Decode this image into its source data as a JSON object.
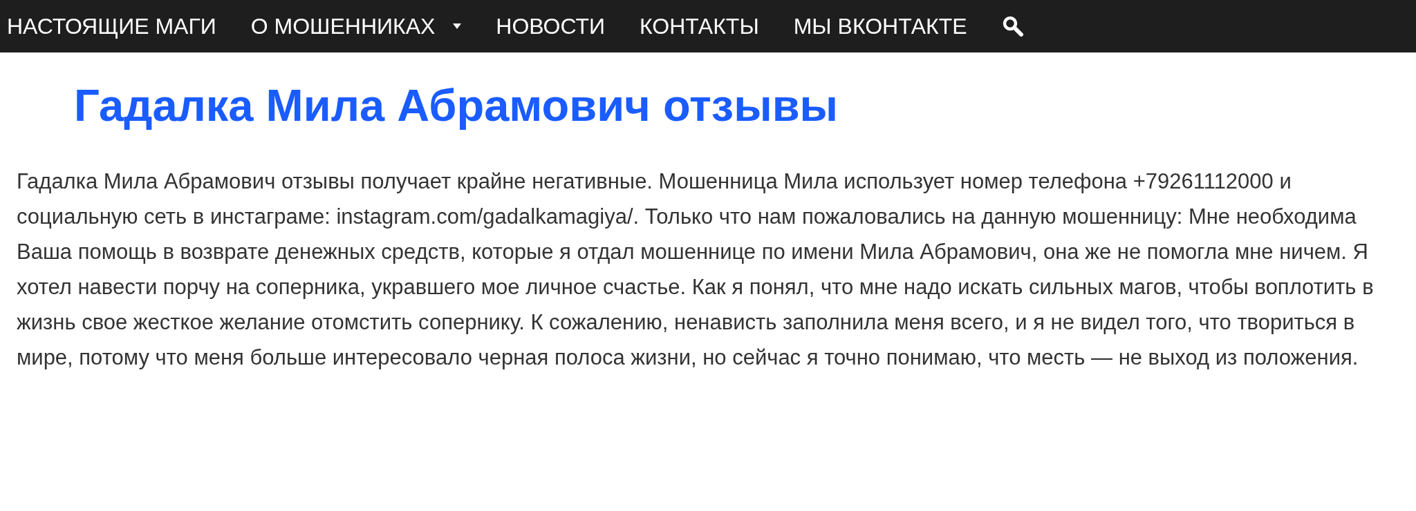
{
  "nav": {
    "items": [
      {
        "label": "НАСТОЯЩИЕ МАГИ",
        "dropdown": false
      },
      {
        "label": "О МОШЕННИКАХ",
        "dropdown": true
      },
      {
        "label": "НОВОСТИ",
        "dropdown": false
      },
      {
        "label": "КОНТАКТЫ",
        "dropdown": false
      },
      {
        "label": "МЫ ВКОНТАКТЕ",
        "dropdown": false
      }
    ]
  },
  "title": "Гадалка Мила Абрамович отзывы",
  "body": "Гадалка Мила Абрамович отзывы получает крайне негативные. Мошенница Мила использует номер телефона +79261112000 и социальную сеть в инстаграме: instagram.com/gadalkamagiya/. Только что нам пожаловались на данную мошенницу: Мне необходима Ваша помощь в возврате денежных средств, которые я отдал мошеннице по имени Мила Абрамович, она же не помогла мне ничем. Я хотел навести порчу на соперника, укравшего мое личное счастье. Как я понял, что мне надо искать сильных магов, чтобы воплотить в жизнь свое жесткое желание отомстить сопернику. К сожалению, ненависть заполнила меня всего, и я не видел того, что твориться в мире, потому что меня больше интересовало черная полоса жизни, но сейчас я точно понимаю, что месть — не выход из положения."
}
